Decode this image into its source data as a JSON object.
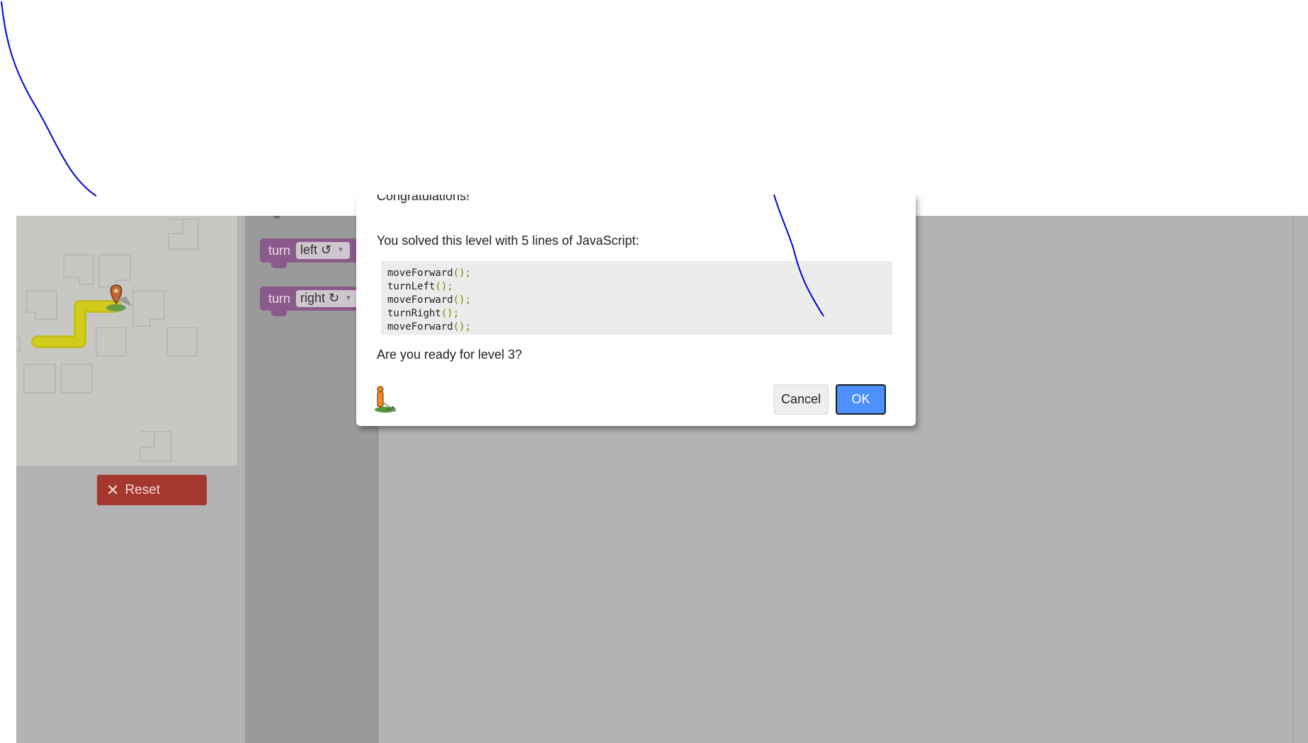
{
  "reset_button": {
    "label": "Reset",
    "icon": "close-icon"
  },
  "toolbox": {
    "blocks": [
      {
        "keyword": "turn",
        "option": "left ↺"
      },
      {
        "keyword": "turn",
        "option": "right ↻"
      }
    ]
  },
  "dialog": {
    "heading": "Congratulations!",
    "message": "You solved this level with 5 lines of JavaScript:",
    "code": [
      {
        "fn": "moveForward",
        "args": "();"
      },
      {
        "fn": "turnLeft",
        "args": "();"
      },
      {
        "fn": "moveForward",
        "args": "();"
      },
      {
        "fn": "turnRight",
        "args": "();"
      },
      {
        "fn": "moveForward",
        "args": "();"
      }
    ],
    "question": "Are you ready for level 3?",
    "cancel_label": "Cancel",
    "ok_label": "OK"
  },
  "colors": {
    "ok_button": "#4d90fe",
    "reset_button": "#a5382e",
    "block": "#8a5a8a",
    "maze_path": "#e8e200",
    "overlay": "#b3b3b3",
    "annotation_stroke": "#0000dd"
  }
}
